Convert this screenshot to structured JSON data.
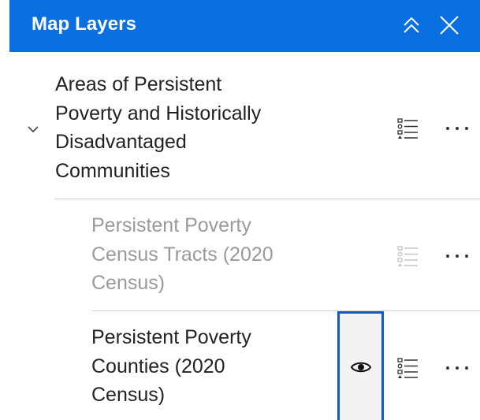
{
  "header": {
    "title": "Map Layers",
    "background_color": "#0a6fe0",
    "collapse_icon": "double-chevron-up-icon",
    "close_icon": "close-icon"
  },
  "layers": {
    "group": {
      "title_lines": [
        "Areas of Persistent",
        "Poverty and Historically",
        "Disadvantaged",
        "Communities"
      ],
      "expanded": true,
      "expand_icon": "chevron-down-icon",
      "legend_icon": "legend-list-icon",
      "more_icon": "more-dots-icon"
    },
    "children": [
      {
        "title_lines": [
          "Persistent Poverty",
          "Census Tracts (2020",
          "Census)"
        ],
        "state": "disabled",
        "legend_icon": "legend-list-icon",
        "more_icon": "more-dots-icon"
      },
      {
        "title_lines": [
          "Persistent Poverty",
          "Counties (2020",
          "Census)"
        ],
        "state": "visible",
        "visibility_icon": "eye-icon",
        "legend_icon": "legend-list-icon",
        "more_icon": "more-dots-icon"
      }
    ]
  },
  "colors": {
    "accent": "#0a6fe0",
    "focus_border": "#0c5dbd",
    "text": "#222222",
    "disabled_text": "#9a9a9a",
    "divider": "#d0d0d0"
  }
}
